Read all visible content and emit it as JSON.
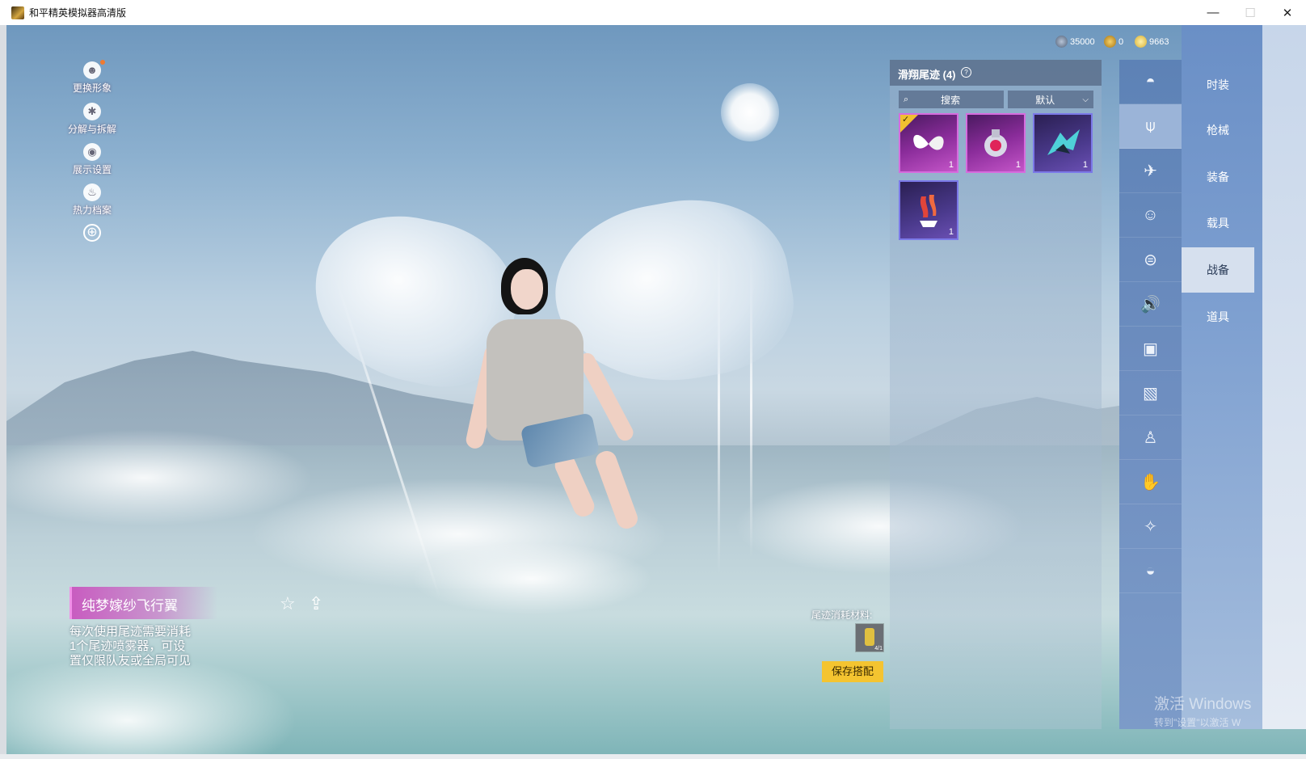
{
  "window": {
    "title": "和平精英模拟器高清版",
    "minimize": "—",
    "maximize": "☐",
    "close": "✕"
  },
  "currency": [
    {
      "icon": "diamond-coin-icon",
      "value": "35000",
      "color": "#5a6e8a"
    },
    {
      "icon": "gold-coin-icon",
      "value": "0",
      "color": "#c8951a"
    },
    {
      "icon": "silver-coin-icon",
      "value": "9663",
      "color": "#e6c44a"
    }
  ],
  "left_tools": [
    {
      "label": "更换形象",
      "icon": "avatar-icon",
      "glyph": "☻"
    },
    {
      "label": "分解与拆解",
      "icon": "decompose-icon",
      "glyph": "✱"
    },
    {
      "label": "展示设置",
      "icon": "eye-icon",
      "glyph": "◉"
    },
    {
      "label": "热力档案",
      "icon": "flame-icon",
      "glyph": "♨"
    }
  ],
  "zoom_glyph": "⊕",
  "item": {
    "name": "纯梦嫁纱飞行翼",
    "description_lines": [
      "每次使用尾迹需要消耗",
      "1个尾迹喷雾器，可设",
      "置仅限队友或全局可见"
    ]
  },
  "panel": {
    "title": "滑翔尾迹 (4)",
    "help": "?",
    "search_placeholder": "搜索",
    "sort_value": "默认",
    "slots": [
      {
        "qty": "1",
        "rarity": "purple",
        "equipped": true,
        "icon": "wings-trail-icon"
      },
      {
        "qty": "1",
        "rarity": "purple",
        "equipped": false,
        "icon": "mech-trail-icon"
      },
      {
        "qty": "1",
        "rarity": "blue",
        "equipped": false,
        "icon": "dragon-trail-icon"
      },
      {
        "qty": "1",
        "rarity": "blue",
        "equipped": false,
        "icon": "flame-trail-icon"
      }
    ]
  },
  "material": {
    "label": "尾迹消耗材料:",
    "count": "4/1"
  },
  "save_label": "保存搭配",
  "nav_icons": [
    {
      "icon": "helmet-icon",
      "glyph": "◓"
    },
    {
      "icon": "glider-icon",
      "glyph": "⍦"
    },
    {
      "icon": "plane-icon",
      "glyph": "✈"
    },
    {
      "icon": "emote-icon",
      "glyph": "☺"
    },
    {
      "icon": "robot-icon",
      "glyph": "⊜"
    },
    {
      "icon": "speaker-icon",
      "glyph": "🔊"
    },
    {
      "icon": "badge-icon",
      "glyph": "▣"
    },
    {
      "icon": "photo-icon",
      "glyph": "▧"
    },
    {
      "icon": "spray-icon",
      "glyph": "♙"
    },
    {
      "icon": "hand-icon",
      "glyph": "✋"
    },
    {
      "icon": "sparkle-icon",
      "glyph": "✧"
    },
    {
      "icon": "turkey-icon",
      "glyph": "◒"
    }
  ],
  "categories": [
    "时装",
    "枪械",
    "装备",
    "载具",
    "战备",
    "道具"
  ],
  "active_category_index": 4,
  "watermark": {
    "line1": "激活 Windows",
    "line2": "转到\"设置\"以激活 W"
  }
}
